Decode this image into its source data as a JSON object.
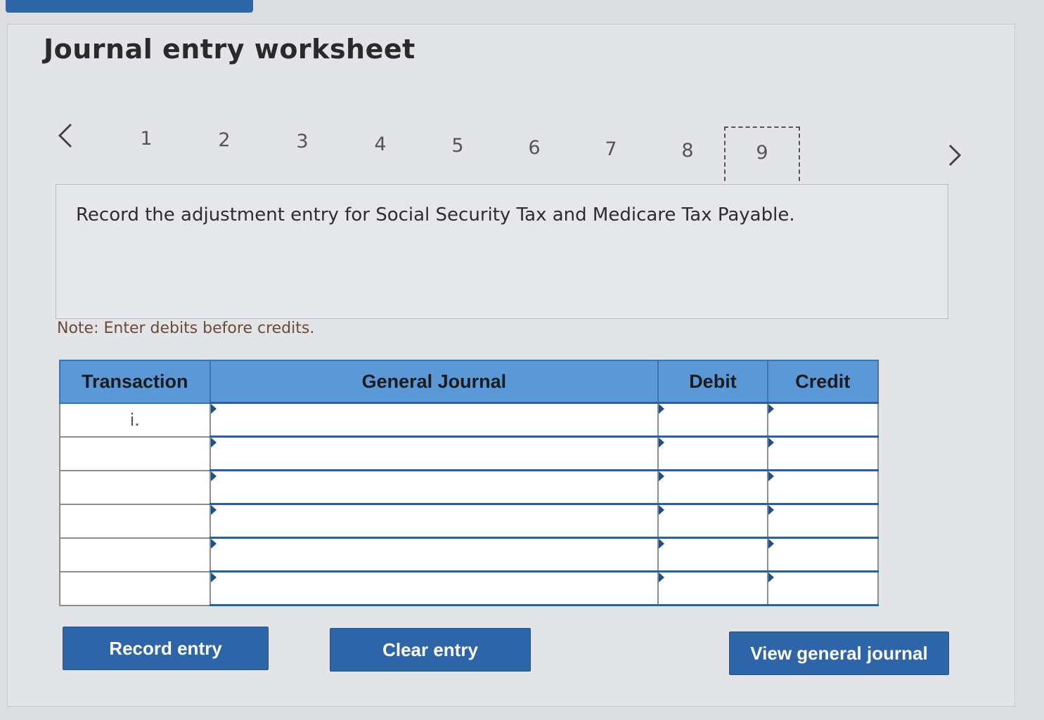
{
  "page": {
    "title": "Journal entry worksheet"
  },
  "navigation": {
    "prev_icon": "chevron-left-icon",
    "next_icon": "chevron-right-icon",
    "steps": [
      "1",
      "2",
      "3",
      "4",
      "5",
      "6",
      "7",
      "8",
      "9"
    ],
    "active_step": "9"
  },
  "instruction": {
    "text": "Record the adjustment entry for Social Security Tax and Medicare Tax Payable."
  },
  "note": {
    "text": "Note: Enter debits before credits."
  },
  "journal_table": {
    "headers": {
      "transaction": "Transaction",
      "general_journal": "General Journal",
      "debit": "Debit",
      "credit": "Credit"
    },
    "rows": [
      {
        "transaction": "i.",
        "account": "",
        "debit": "",
        "credit": ""
      },
      {
        "transaction": "",
        "account": "",
        "debit": "",
        "credit": ""
      },
      {
        "transaction": "",
        "account": "",
        "debit": "",
        "credit": ""
      },
      {
        "transaction": "",
        "account": "",
        "debit": "",
        "credit": ""
      },
      {
        "transaction": "",
        "account": "",
        "debit": "",
        "credit": ""
      },
      {
        "transaction": "",
        "account": "",
        "debit": "",
        "credit": ""
      }
    ]
  },
  "buttons": {
    "record_entry": "Record entry",
    "clear_entry": "Clear entry",
    "view_general_journal": "View general journal"
  },
  "colors": {
    "accent": "#2e65a9",
    "table_header": "#5a98d8",
    "background": "#dcdde0"
  }
}
